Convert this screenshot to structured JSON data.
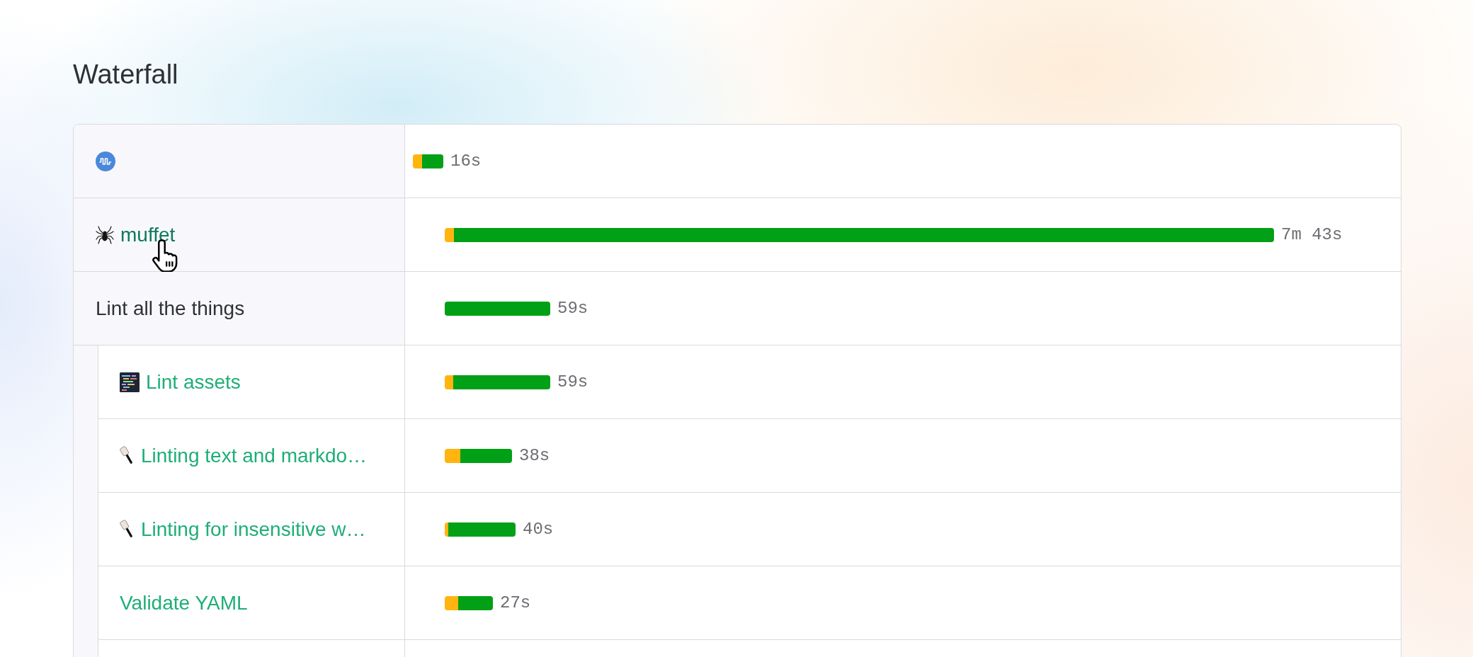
{
  "title": "Waterfall",
  "jobs": [
    {
      "kind": "icon",
      "duration": "16s"
    },
    {
      "kind": "link",
      "name": "muffet",
      "hovered": true,
      "duration": "7m 43s"
    },
    {
      "kind": "group",
      "name": "Lint all the things",
      "duration": "59s",
      "children": [
        {
          "kind": "link",
          "name": "Lint assets",
          "hovered": false,
          "duration": "59s"
        },
        {
          "kind": "link",
          "name": "Linting text and markdo…",
          "hovered": false,
          "duration": "38s"
        },
        {
          "kind": "link",
          "name": "Linting for insensitive w…",
          "hovered": false,
          "duration": "40s"
        },
        {
          "kind": "link",
          "name": "Validate YAML",
          "hovered": false,
          "duration": "27s"
        }
      ]
    }
  ]
}
